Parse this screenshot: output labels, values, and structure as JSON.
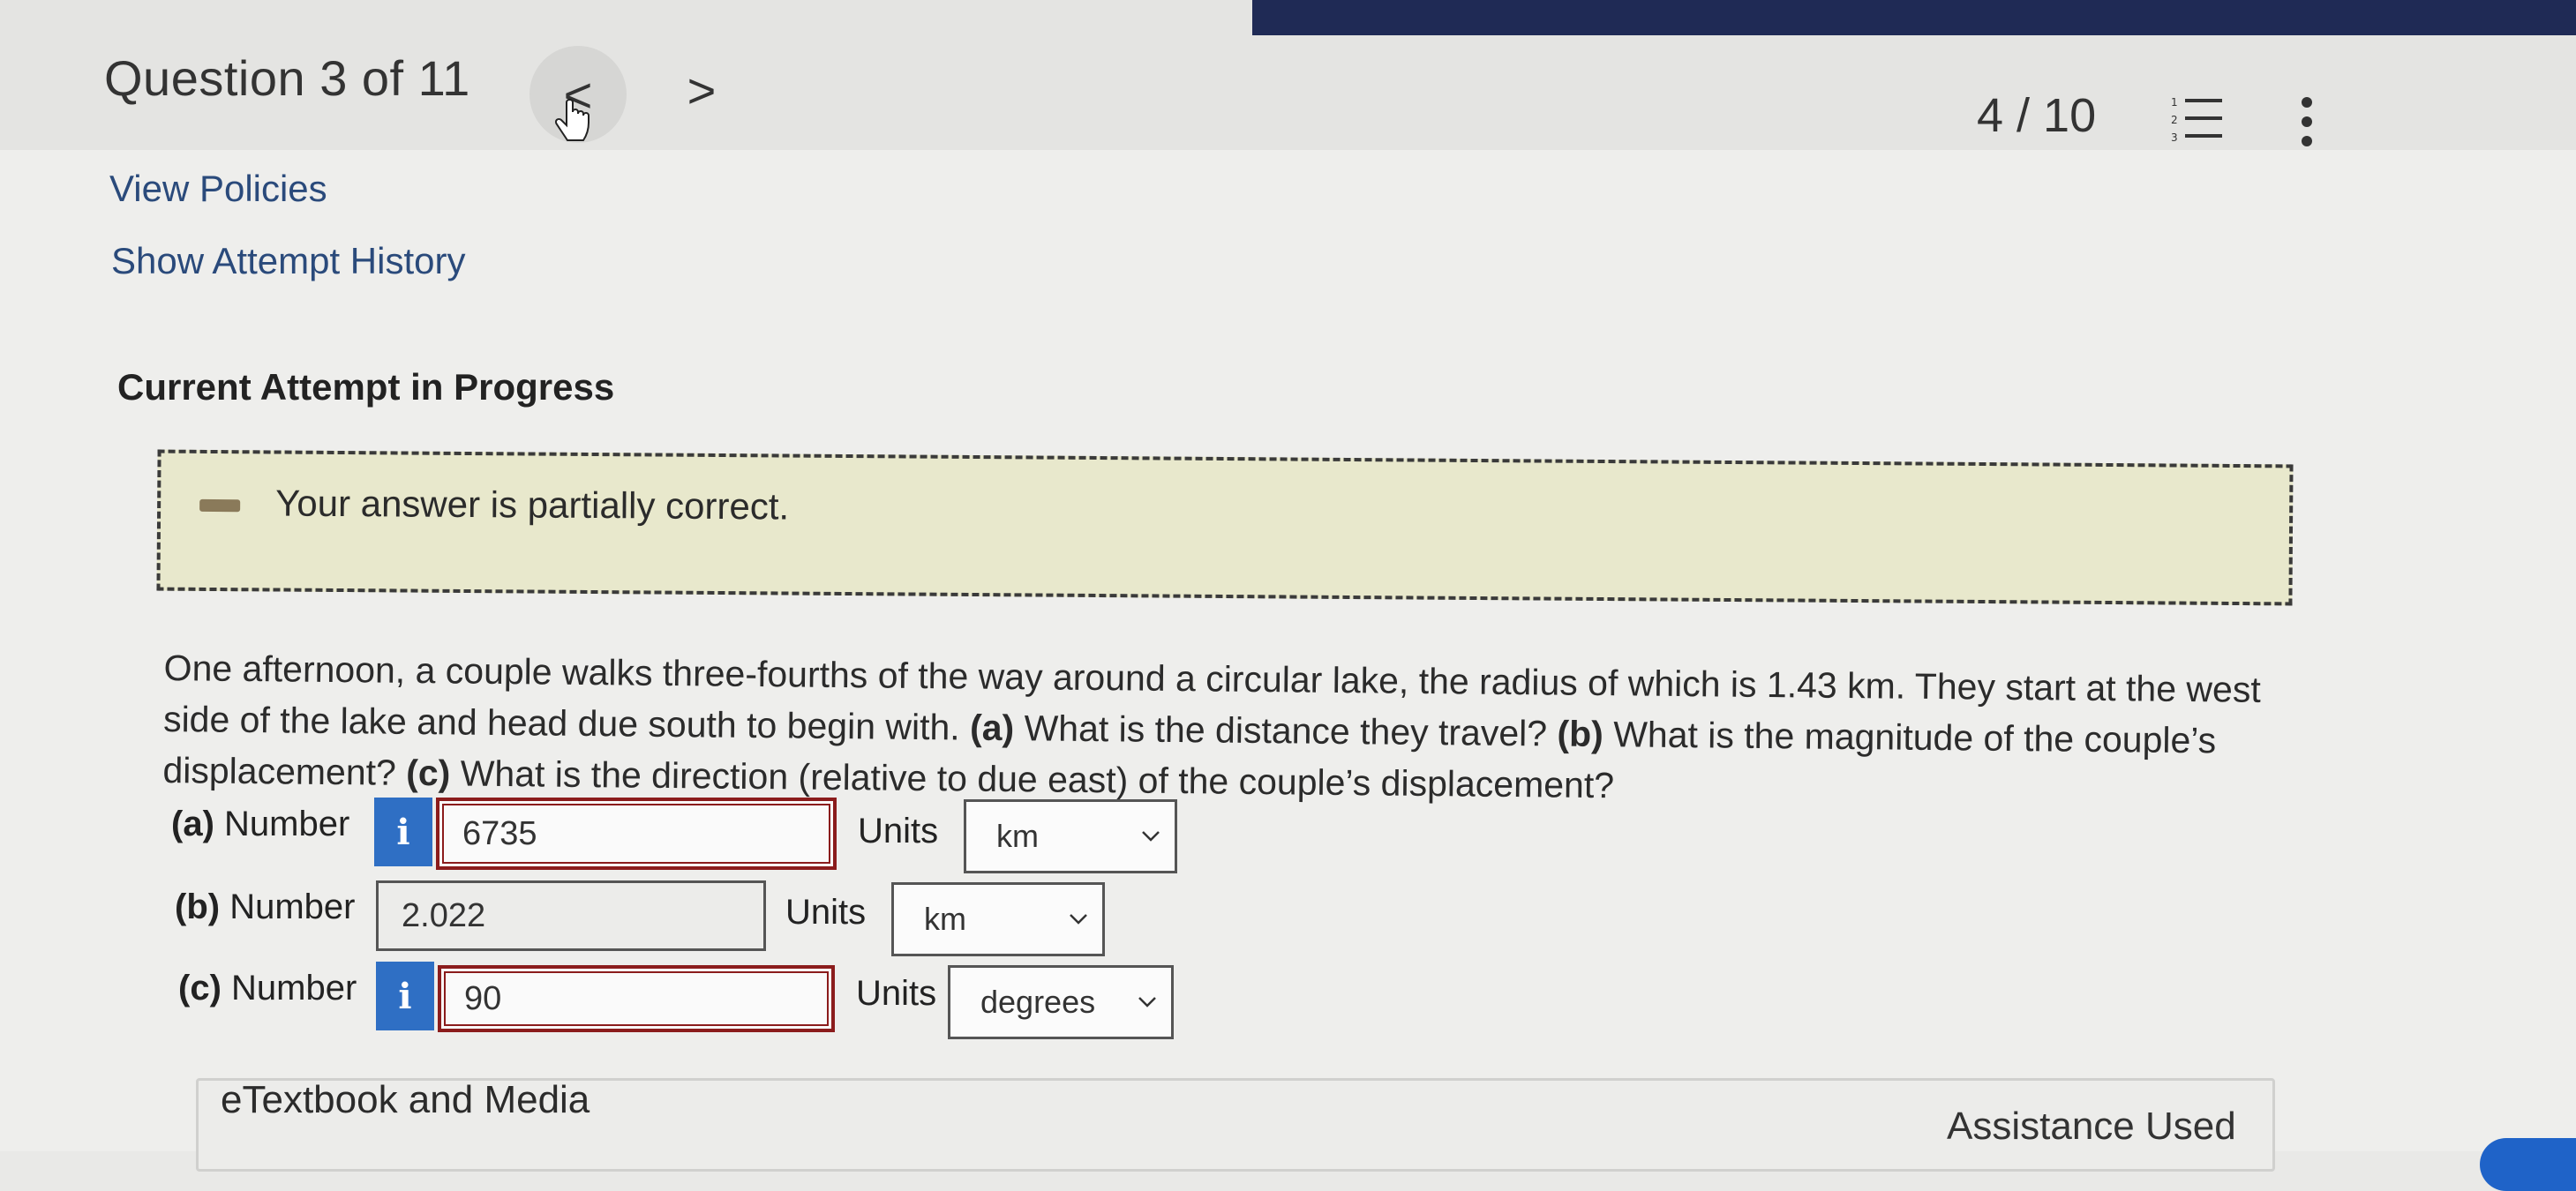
{
  "header": {
    "question_title": "Question 3 of 11",
    "prev_glyph": "<",
    "next_glyph": ">",
    "score": "4 / 10"
  },
  "links": {
    "view_policies": "View Policies",
    "show_attempt_history": "Show Attempt History"
  },
  "attempt_heading": "Current Attempt in Progress",
  "feedback": {
    "text": "Your answer is partially correct."
  },
  "question": {
    "intro": "One afternoon, a couple walks three-fourths of the way around a circular lake, the radius of which is 1.43 km. They start at the west side of the lake and head due south to begin with. ",
    "a_tag": "(a)",
    "a_text": " What is the distance they travel? ",
    "b_tag": "(b)",
    "b_text": " What is the magnitude of the couple’s displacement? ",
    "c_tag": "(c)",
    "c_text": " What is the direction (relative to due east) of the couple’s displacement?"
  },
  "answers": [
    {
      "tag": "(a)",
      "label": "Number",
      "info": "i",
      "value": "6735",
      "units_label": "Units",
      "unit": "km"
    },
    {
      "tag": "(b)",
      "label": "Number",
      "value": "2.022",
      "units_label": "Units",
      "unit": "km"
    },
    {
      "tag": "(c)",
      "label": "Number",
      "info": "i",
      "value": "90",
      "units_label": "Units",
      "unit": "degrees"
    }
  ],
  "footer": {
    "etextbook": "eTextbook and Media",
    "assistance": "Assistance Used"
  },
  "colors": {
    "link": "#2a4a7b",
    "info_button": "#2f6fc4",
    "incorrect_border": "#8b1c1c",
    "feedback_bg": "#e8e8cc",
    "nav_band": "#1f2a55"
  },
  "icons": {
    "prev": "chevron-left-icon",
    "next": "chevron-right-icon",
    "list": "numbered-list-icon",
    "more": "vertical-ellipsis-icon",
    "partial": "partial-correct-icon",
    "select": "chevron-down-icon"
  }
}
